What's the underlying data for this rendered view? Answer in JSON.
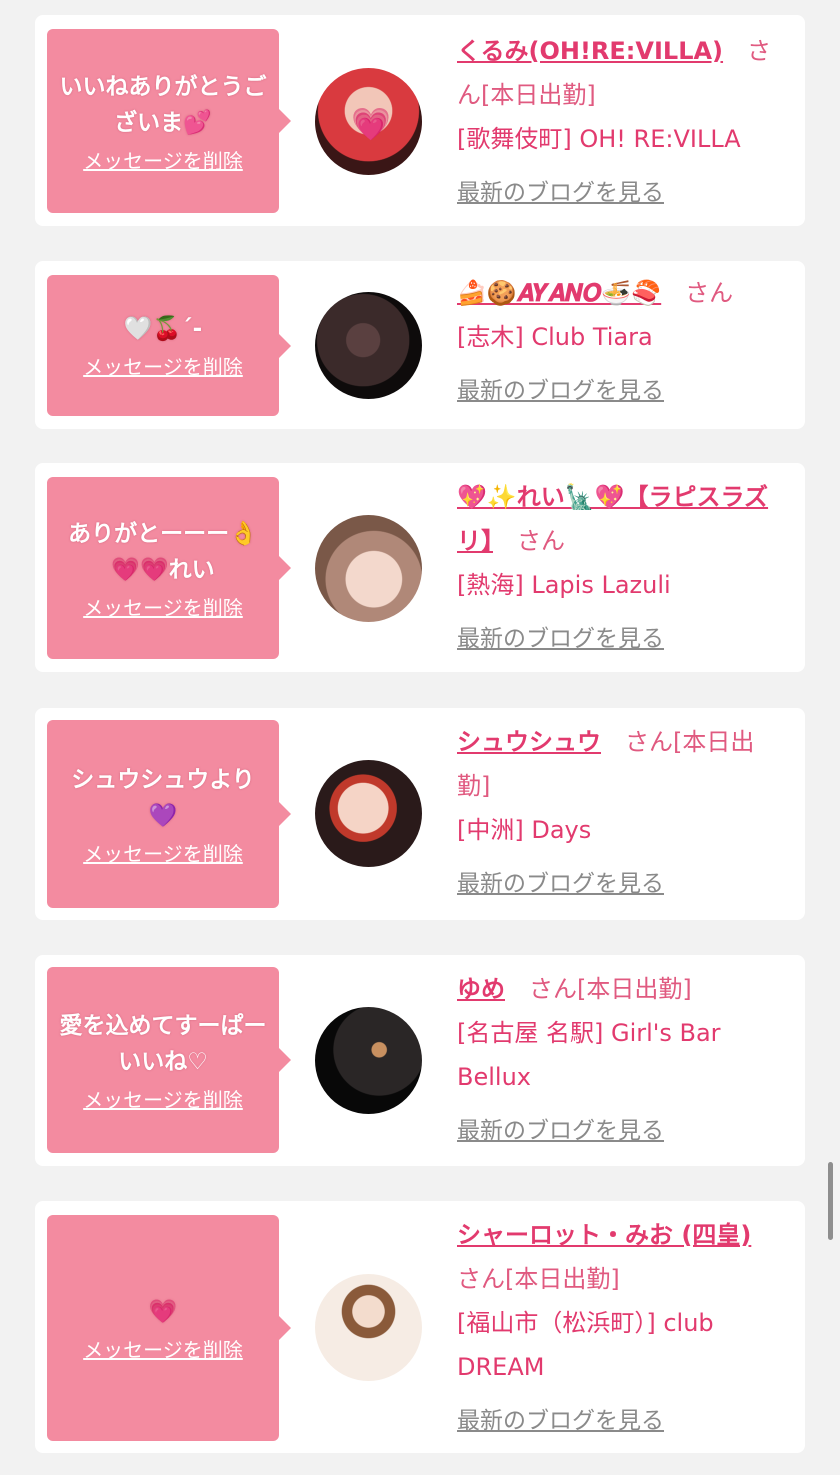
{
  "messages": [
    {
      "message": "いいねありがとうございま💕",
      "delete_label": "メッセージを削除",
      "name": "くるみ(OH!RE:VILLA)",
      "suffix": "　さん[本日出勤]",
      "shop": "[歌舞伎町] OH! RE:VILLA",
      "blog_label": "最新のブログを見る",
      "avatar_colors": [
        "#d93a3f",
        "#3a1616"
      ]
    },
    {
      "message": "🤍🍒ˊ-",
      "delete_label": "メッセージを削除",
      "name": "🍰🍪𝑨𝒀𝑨𝑵𝑶🍜🍣",
      "suffix": "　さん",
      "shop": "[志木] Club Tiara",
      "blog_label": "最新のブログを見る",
      "avatar_colors": [
        "#3b2a2a",
        "#0e0b0b"
      ]
    },
    {
      "message": "ありがとーーー👌💗💗れい",
      "delete_label": "メッセージを削除",
      "name": "💖✨れい🗽💖【ラピスラズリ】",
      "suffix": "　さん",
      "shop": "[熱海] Lapis Lazuli",
      "blog_label": "最新のブログを見る",
      "avatar_colors": [
        "#e8c9bd",
        "#7a5848"
      ]
    },
    {
      "message": "シュウシュウより💜",
      "delete_label": "メッセージを削除",
      "name": "シュウシュウ",
      "suffix": "　さん[本日出勤]",
      "shop": "[中洲] Days",
      "blog_label": "最新のブログを見る",
      "avatar_colors": [
        "#f0c8b8",
        "#2a1a1a"
      ]
    },
    {
      "message": "愛を込めてすーぱーいいね♡",
      "delete_label": "メッセージを削除",
      "name": "ゆめ",
      "suffix": "　さん[本日出勤]",
      "shop": "[名古屋 名駅] Girl's Bar Bellux",
      "blog_label": "最新のブログを見る",
      "avatar_colors": [
        "#2a2626",
        "#080808"
      ]
    },
    {
      "message": "💗",
      "delete_label": "メッセージを削除",
      "name": "シャーロット・みお (四皇)",
      "suffix": "　さん[本日出勤]",
      "shop": "[福山市（松浜町）] club DREAM",
      "blog_label": "最新のブログを見る",
      "avatar_colors": [
        "#f6ece4",
        "#b08060"
      ]
    }
  ]
}
